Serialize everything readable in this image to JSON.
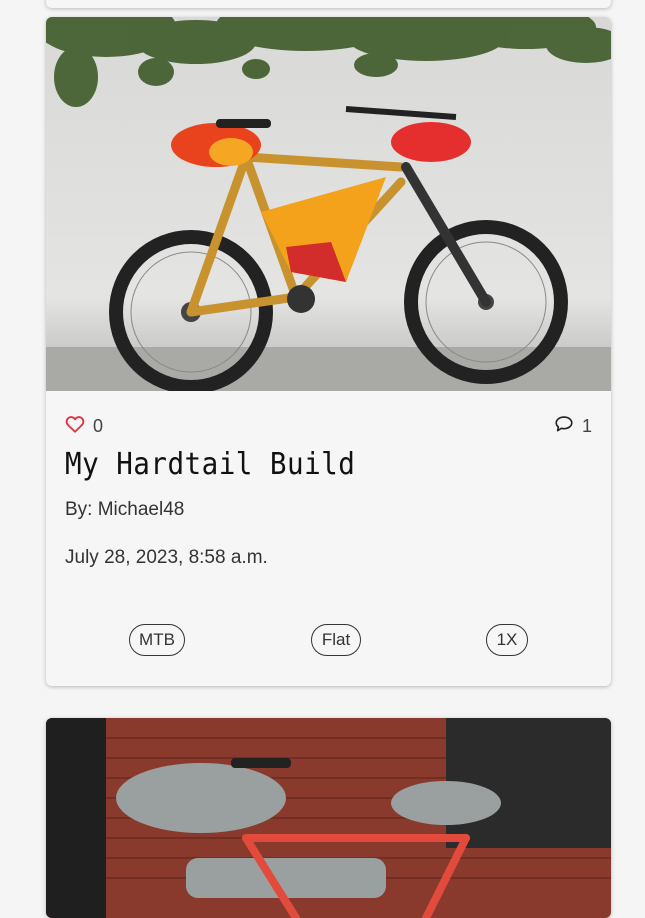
{
  "posts": [
    {
      "image_alt": "Orange hardtail mountain bike with red bikepacking bags",
      "likes": "0",
      "comments": "1",
      "title": "My Hardtail Build",
      "author": "By: Michael48",
      "date": "July 28, 2023, 8:58 a.m.",
      "tags": [
        "MTB",
        "Flat",
        "1X"
      ]
    }
  ],
  "colors": {
    "heart": "#e0323a",
    "card_bg": "#f6f6f6",
    "page_bg": "#f5f5f5"
  },
  "icons": {
    "like": "heart-outline-icon",
    "comment": "speech-bubble-icon"
  }
}
